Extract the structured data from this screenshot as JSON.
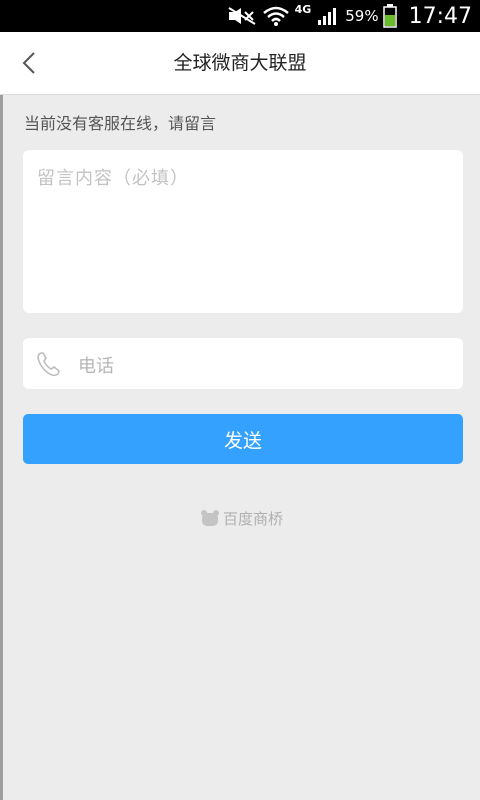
{
  "status_bar": {
    "network": "4G",
    "battery_percent": "59%",
    "time": "17:47",
    "icons": [
      "mute-icon",
      "wifi-icon",
      "signal-icon",
      "battery-icon"
    ]
  },
  "header": {
    "title": "全球微商大联盟",
    "back_icon": "back-arrow-icon"
  },
  "form": {
    "notice": "当前没有客服在线，请留言",
    "message_placeholder": "留言内容（必填）",
    "phone_placeholder": "电话",
    "phone_icon": "phone-icon",
    "send_label": "发送"
  },
  "footer": {
    "brand": "百度商桥",
    "brand_icon": "bear-logo-icon"
  },
  "colors": {
    "accent": "#34a1ff",
    "page_bg": "#ececec",
    "status_bar_bg": "#000000",
    "battery_green": "#6abb2a"
  }
}
